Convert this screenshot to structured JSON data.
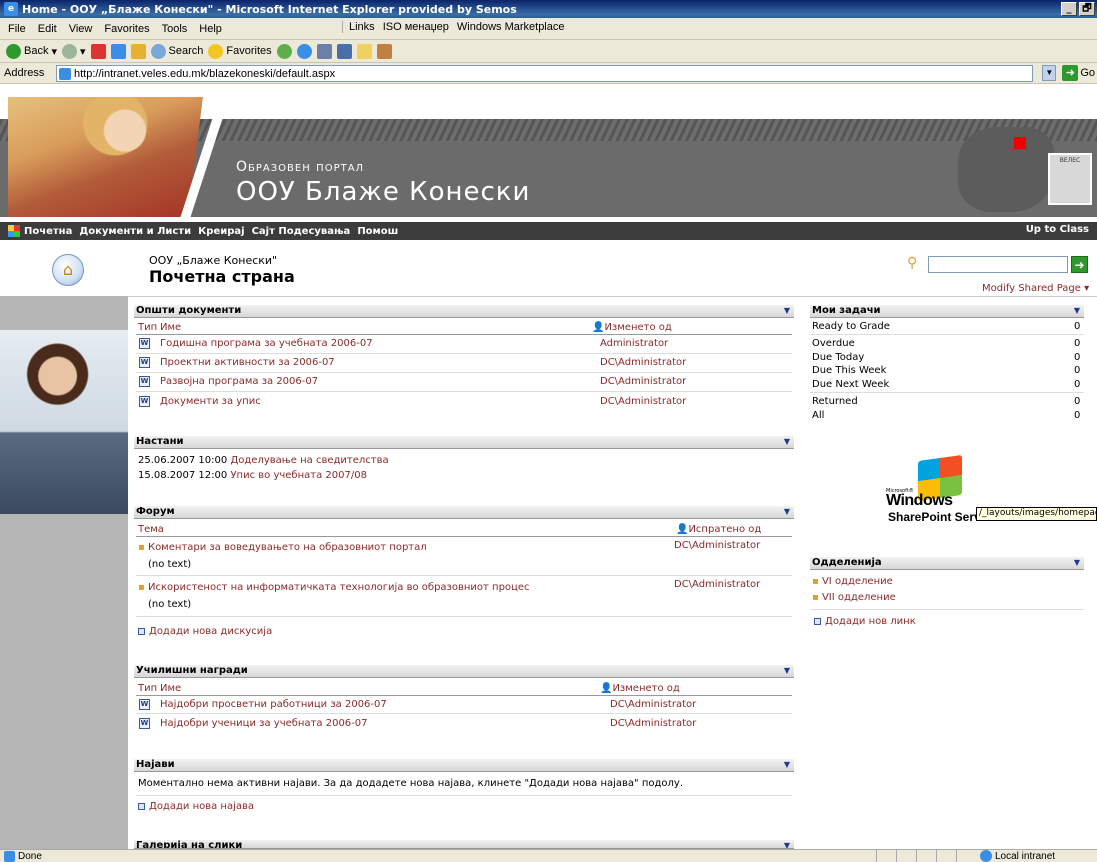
{
  "window": {
    "title": "Home - ООУ „Блаже Конески\" - Microsoft Internet Explorer provided by Semos",
    "minimize": "_",
    "restore": "🗗"
  },
  "menu": {
    "items": [
      "File",
      "Edit",
      "View",
      "Favorites",
      "Tools",
      "Help"
    ],
    "links_label": "Links",
    "links": [
      "ISO менаџер",
      "Windows Marketplace"
    ]
  },
  "toolbar": {
    "back": "Back",
    "search": "Search",
    "favorites": "Favorites"
  },
  "address": {
    "label": "Address",
    "url": "http://intranet.veles.edu.mk/blazekoneski/default.aspx",
    "go": "Go"
  },
  "banner": {
    "subtitle": "Образовен портал",
    "title": "ООУ Блаже Конески",
    "crest_text": "ВЕЛЕС"
  },
  "nav": {
    "items": [
      "Почетна",
      "Документи и Листи",
      "Креирај",
      "Сајт Подесувања",
      "Помош"
    ],
    "right_link": "Up to Class"
  },
  "header": {
    "site_name": "ООУ „Блаже Конески\"",
    "page_title": "Почетна страна",
    "modify": "Modify Shared Page ▾"
  },
  "general_docs": {
    "title": "Општи документи",
    "col_type": "Тип",
    "col_name": "Име",
    "col_modified": "Изменето од",
    "rows": [
      {
        "name": "Годишна програма за учебната 2006-07",
        "by": "Administrator"
      },
      {
        "name": "Проектни активности за 2006-07",
        "by": "DC\\Administrator"
      },
      {
        "name": "Развојна програма за 2006-07",
        "by": "DC\\Administrator"
      },
      {
        "name": "Документи за упис",
        "by": "DC\\Administrator"
      }
    ]
  },
  "events": {
    "title": "Настани",
    "rows": [
      {
        "when": "25.06.2007 10:00",
        "what": "Доделување на сведителства"
      },
      {
        "when": "15.08.2007 12:00",
        "what": "Упис во учебната 2007/08"
      }
    ]
  },
  "forum": {
    "title": "Форум",
    "col_topic": "Тема",
    "col_sent": "Испратено од",
    "rows": [
      {
        "topic": "Коментари за воведувањето на образовниот портал",
        "by": "DC\\Administrator",
        "body": "(no text)"
      },
      {
        "topic": "Искористеност на информатичката технологија во образовниот процес",
        "by": "DC\\Administrator",
        "body": "(no text)"
      }
    ],
    "add": "Додади нова дискусија"
  },
  "awards": {
    "title": "Училишни награди",
    "col_type": "Тип",
    "col_name": "Име",
    "col_modified": "Изменето од",
    "rows": [
      {
        "name": "Најдобри просветни работници за 2006-07",
        "by": "DC\\Administrator"
      },
      {
        "name": "Најдобри ученици за учебната 2006-07",
        "by": "DC\\Administrator"
      }
    ]
  },
  "announcements": {
    "title": "Најави",
    "empty": "Моментално нема активни најави. За да додадете нова најава, клинете \"Додади нова најава\" подолу.",
    "add": "Додади нова најава"
  },
  "gallery": {
    "title": "Галерија на слики"
  },
  "tasks": {
    "title": "Мои задачи",
    "rows": [
      {
        "label": "Ready to Grade",
        "count": "0"
      },
      {
        "label": "Overdue",
        "count": "0"
      },
      {
        "label": "Due Today",
        "count": "0"
      },
      {
        "label": "Due This Week",
        "count": "0"
      },
      {
        "label": "Due Next Week",
        "count": "0"
      },
      {
        "label": "Returned",
        "count": "0"
      },
      {
        "label": "All",
        "count": "0"
      }
    ]
  },
  "logo": {
    "microsoft": "Microsoft®",
    "windows": "Windows",
    "sharepoint": "SharePoint Services",
    "tooltip": "/_layouts/images/homepage.gif"
  },
  "classes": {
    "title": "Одделенија",
    "items": [
      "VI одделение",
      "VII одделение"
    ],
    "add": "Додади нов линк"
  },
  "status": {
    "text": "Done",
    "zone": "Local intranet"
  }
}
